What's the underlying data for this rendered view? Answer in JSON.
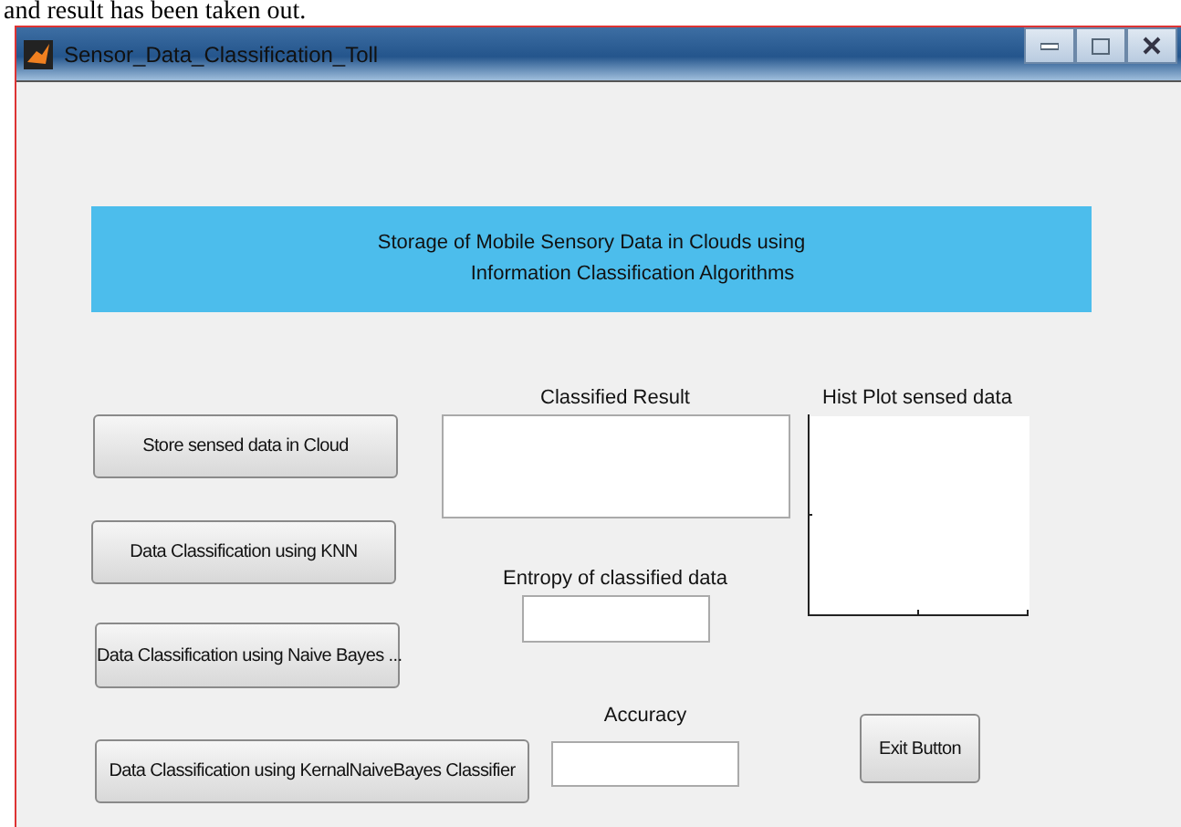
{
  "caption_fragment": "and result has been taken out.",
  "window": {
    "title": "Sensor_Data_Classification_Toll"
  },
  "banner": {
    "lines": [
      "Storage of Mobile Sensory Data in Clouds using",
      "Information Classification Algorithms"
    ]
  },
  "buttons": [
    {
      "label": "Store sensed data in Cloud"
    },
    {
      "label": "Data Classification using KNN"
    },
    {
      "label": "Data Classification using Naive Bayes ..."
    },
    {
      "label": "Data Classification using KernalNaiveBayes Classifier"
    }
  ],
  "classified_result": {
    "label": "Classified Result"
  },
  "entropy": {
    "label": "Entropy of classified data"
  },
  "accuracy": {
    "label": "Accuracy"
  },
  "hist_plot": {
    "title": "Hist Plot sensed data"
  },
  "exit_button": {
    "label": "Exit Button"
  }
}
